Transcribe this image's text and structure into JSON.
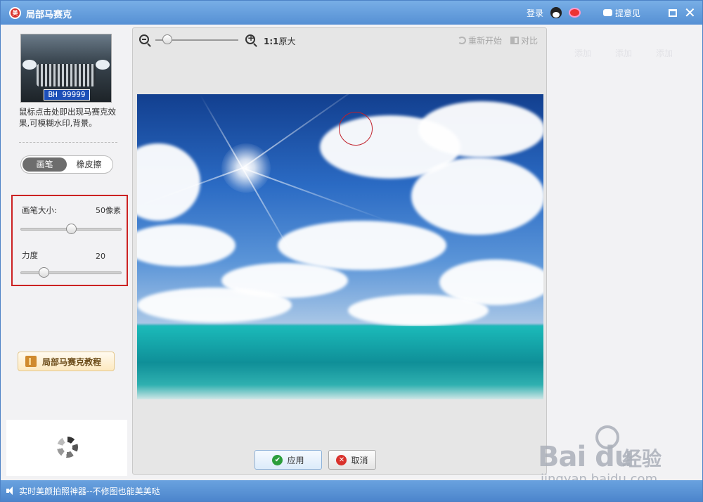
{
  "titlebar": {
    "title": "局部马赛克",
    "login": "登录",
    "feedback": "提意见"
  },
  "left": {
    "thumb_plate": "BH 99999",
    "description": "鼠标点击处即出现马赛克效果,可模糊水印,背景。",
    "tools": [
      "画笔",
      "橡皮擦"
    ],
    "active_tool": "画笔",
    "brush_size_label": "画笔大小:",
    "brush_size_value": "50像素",
    "brush_size_level": 0.5,
    "strength_label": "力度",
    "strength_value": "20",
    "strength_level": 0.2,
    "tutorial_label": "局部马赛克教程"
  },
  "editor": {
    "zoom_ratio": "1:1",
    "zoom_label": "原大",
    "restart_label": "重新开始",
    "compare_label": "对比",
    "apply_label": "应用",
    "cancel_label": "取消"
  },
  "right_tabs": [
    "添加",
    "添加",
    "添加"
  ],
  "watermark": {
    "brand_latin": "Bai du",
    "brand_cn": "经验",
    "url": "jingyan.baidu.com"
  },
  "statusbar": {
    "message": "实时美颜拍照神器--不修图也能美美哒"
  },
  "colors": {
    "titlebar": "#5b93d6",
    "highlight_box": "#cc2222",
    "brush_cursor": "#c0202a"
  }
}
